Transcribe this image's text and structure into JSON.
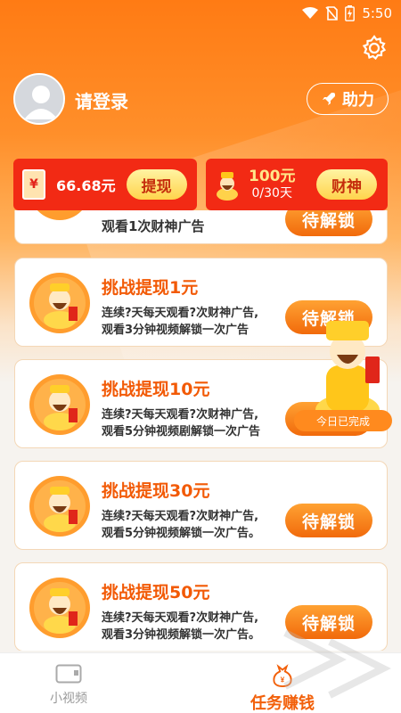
{
  "status_bar": {
    "time": "5:50"
  },
  "profile": {
    "login_text": "请登录",
    "help_label": "助力"
  },
  "cards": {
    "balance": {
      "amount": "66.68元",
      "button": "提现",
      "envelope_char": "¥"
    },
    "wealth": {
      "amount": "100元",
      "progress": "0/30天",
      "button": "财神"
    }
  },
  "partial_task": {
    "desc": "观看1次财神广告",
    "button": "待解锁"
  },
  "tasks": [
    {
      "title": "挑战提现1元",
      "line1": "连续?天每天观看?次财神广告,",
      "line2": "观看3分钟视频解锁一次广告",
      "button": "待解锁"
    },
    {
      "title": "挑战提现10元",
      "line1": "连续?天每天观看?次财神广告,",
      "line2": "观看5分钟视频剧解锁一次广告",
      "button": "待解锁"
    },
    {
      "title": "挑战提现30元",
      "line1": "连续?天每天观看?次财神广告,",
      "line2": "观看5分钟视频解锁一次广告。",
      "button": "待解锁"
    },
    {
      "title": "挑战提现50元",
      "line1": "连续?天每天观看?次财神广告,",
      "line2": "观看3分钟视频解锁一次广告。",
      "button": "待解锁"
    }
  ],
  "floating_widget": {
    "badge": "今日已完成"
  },
  "tabbar": {
    "items": [
      {
        "label": "小视频",
        "icon": "video-icon",
        "active": false
      },
      {
        "label": "任务赚钱",
        "icon": "money-bag-icon",
        "active": true
      }
    ]
  },
  "colors": {
    "primary": "#ff7b14",
    "accent_red": "#f22a14",
    "title_orange": "#f25a06",
    "button_orange": "#f16a0b"
  }
}
